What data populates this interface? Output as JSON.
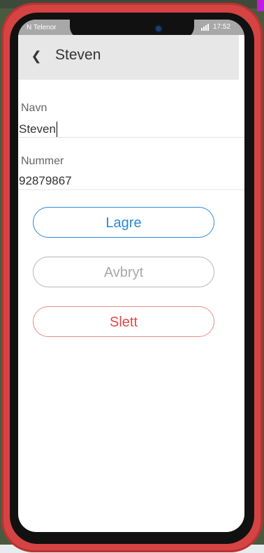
{
  "status_bar": {
    "carrier": "N Telenor",
    "time": "17:52"
  },
  "header": {
    "title": "Steven"
  },
  "form": {
    "name_label": "Navn",
    "name_value": "Steven",
    "number_label": "Nummer",
    "number_value": "92879867"
  },
  "buttons": {
    "save": "Lagre",
    "cancel": "Avbryt",
    "delete": "Slett"
  },
  "colors": {
    "save": "#2a8ad8",
    "cancel": "#a8a8a8",
    "delete": "#e04848",
    "case": "#d54443"
  }
}
